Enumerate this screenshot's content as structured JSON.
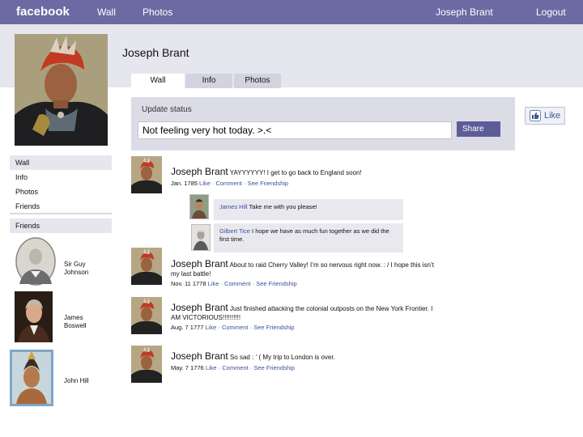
{
  "topbar": {
    "logo": "facebook",
    "nav_wall": "Wall",
    "nav_photos": "Photos",
    "nav_user": "Joseph Brant",
    "nav_logout": "Logout"
  },
  "profile": {
    "name": "Joseph Brant"
  },
  "tabs": [
    {
      "label": "Wall",
      "active": true
    },
    {
      "label": "Info",
      "active": false
    },
    {
      "label": "Photos",
      "active": false
    }
  ],
  "status": {
    "label": "Update status",
    "value": "Not feeling very hot today. >.<",
    "share_label": "Share"
  },
  "like_button": {
    "label": "Like",
    "icon": "thumbs-up-icon"
  },
  "sidebar": {
    "items": [
      {
        "label": "Wall"
      },
      {
        "label": "Info"
      },
      {
        "label": "Photos"
      },
      {
        "label": "Friends"
      }
    ],
    "friends_header": "Friends",
    "friends": [
      {
        "name": "Sir Guy Johnson"
      },
      {
        "name": "James Boswell"
      },
      {
        "name": "John Hill"
      }
    ]
  },
  "posts": [
    {
      "author": "Joseph Brant",
      "text": "YAYYYYYY! I get to go back to England soon!",
      "date": "Jan. 1785",
      "actions": "Like · Comment · See Friendship"
    },
    {
      "author": "Joseph Brant",
      "text": "About to raid Cherry Valley! I’m so nervous right now. : / I hope this isn’t my last battle!",
      "date": "Nov. 11 1778",
      "actions": "Like · Comment · See Friendship"
    },
    {
      "author": "Joseph Brant",
      "text": "Just finished attacking the colonial outposts on the New York Frontier.  I AM VICTORIOUS!!!!!!!!!!",
      "date": "Aug. 7 1777",
      "actions": "Like · Comment · See Friendship"
    },
    {
      "author": "Joseph Brant",
      "text": "So sad : ‘ ( My trip to London is over.",
      "date": "May. 7 1776",
      "actions": "Like · Comment · See Friendship"
    }
  ],
  "comments": [
    {
      "author": "James Hill",
      "text": "Take me with you please!"
    },
    {
      "author": "Gilbert Tice",
      "text": "I hope we have as much fun together as we did the first time."
    }
  ],
  "colors": {
    "topbar": "#6b6aa3",
    "band": "#e6e6ee",
    "link": "#3b4fa0",
    "share_button": "#5d5c99"
  }
}
